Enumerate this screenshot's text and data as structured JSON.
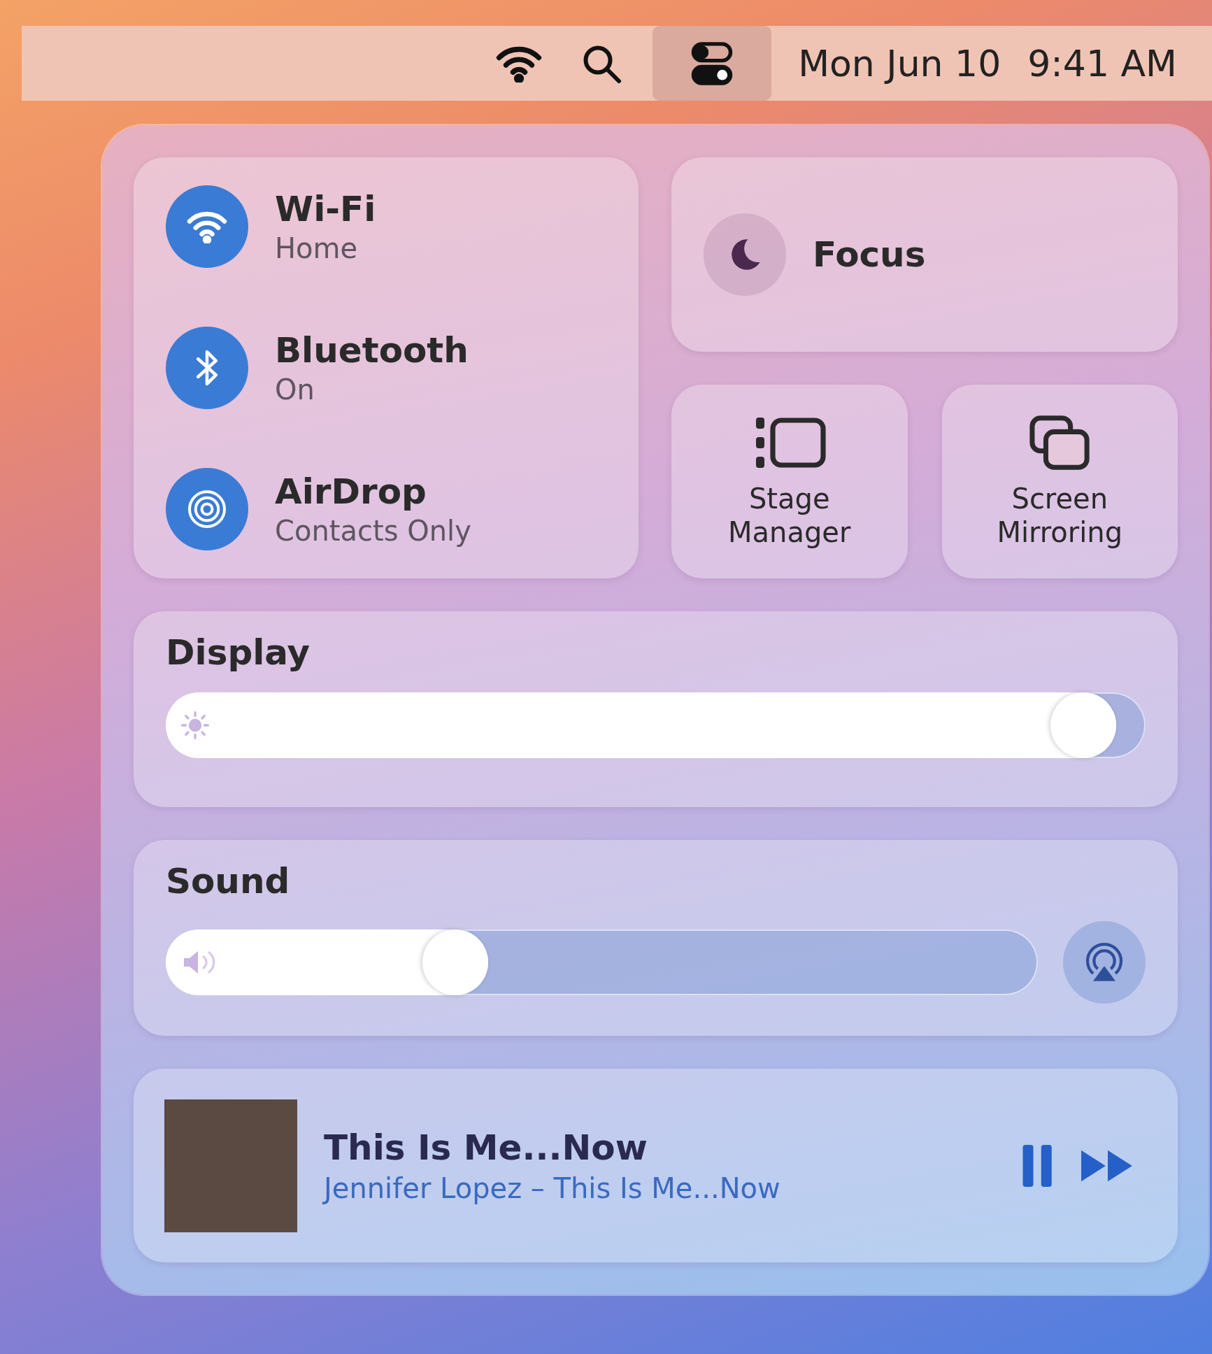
{
  "menu_bar": {
    "control_center_selected": true,
    "date": "Mon Jun 10",
    "time": "9:41 AM"
  },
  "connectivity": [
    {
      "kind": "wifi",
      "title": "Wi-Fi",
      "status": "Home",
      "on": true
    },
    {
      "kind": "bluetooth",
      "title": "Bluetooth",
      "status": "On",
      "on": true
    },
    {
      "kind": "airdrop",
      "title": "AirDrop",
      "status": "Contacts Only",
      "on": true
    }
  ],
  "focus": {
    "label": "Focus",
    "on": false
  },
  "tiles": [
    {
      "kind": "stage",
      "label": "Stage Manager"
    },
    {
      "kind": "mirroring",
      "label": "Screen Mirroring"
    }
  ],
  "display": {
    "title": "Display",
    "level": 0.97
  },
  "sound": {
    "title": "Sound",
    "level": 0.37
  },
  "now_playing": {
    "title": "This Is Me...Now",
    "subtitle": "Jennifer Lopez – This Is Me...Now",
    "playing": true
  }
}
